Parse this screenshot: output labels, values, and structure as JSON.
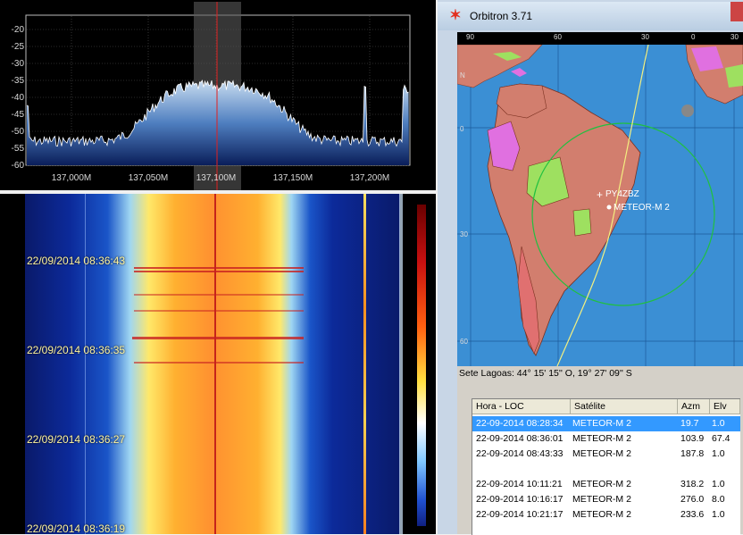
{
  "spectrum": {
    "y_ticks": [
      "-20",
      "-25",
      "-30",
      "-35",
      "-40",
      "-45",
      "-50",
      "-55",
      "-60"
    ],
    "x_ticks": [
      "137,000M",
      "137,050M",
      "137,100M",
      "137,150M",
      "137,200M"
    ]
  },
  "waterfall": {
    "timestamps": [
      "22/09/2014 08:36:43",
      "22/09/2014 08:36:35",
      "22/09/2014 08:36:27",
      "22/09/2014 08:36:19"
    ]
  },
  "orbitron": {
    "title": "Orbitron 3.71",
    "map": {
      "lon_labels": [
        "90",
        "60",
        "30",
        "0",
        "30"
      ],
      "lat_labels": [
        "N",
        "0",
        "30",
        "60"
      ],
      "station_label": "PY4ZBZ",
      "satellite_label": "METEOR-M 2",
      "colors": {
        "ocean": "#3b8fd4",
        "land": "#d27e6e",
        "track": "#f4f080",
        "footprint": "#20c040"
      }
    },
    "status": "Sete Lagoas: 44° 15' 15'' O, 19° 27' 09'' S",
    "table": {
      "headers": [
        "Hora - LOC",
        "Satélite",
        "Azm",
        "Elv"
      ],
      "rows": [
        {
          "time": "22-09-2014 08:28:34",
          "sat": "METEOR-M 2",
          "azm": "19.7",
          "elv": "1.0",
          "selected": true
        },
        {
          "time": "22-09-2014 08:36:01",
          "sat": "METEOR-M 2",
          "azm": "103.9",
          "elv": "67.4",
          "selected": false
        },
        {
          "time": "22-09-2014 08:43:33",
          "sat": "METEOR-M 2",
          "azm": "187.8",
          "elv": "1.0",
          "selected": false
        },
        {
          "time": "",
          "sat": "",
          "azm": "",
          "elv": "",
          "selected": false
        },
        {
          "time": "22-09-2014 10:11:21",
          "sat": "METEOR-M 2",
          "azm": "318.2",
          "elv": "1.0",
          "selected": false
        },
        {
          "time": "22-09-2014 10:16:17",
          "sat": "METEOR-M 2",
          "azm": "276.0",
          "elv": "8.0",
          "selected": false
        },
        {
          "time": "22-09-2014 10:21:17",
          "sat": "METEOR-M 2",
          "azm": "233.6",
          "elv": "1.0",
          "selected": false
        }
      ]
    }
  }
}
